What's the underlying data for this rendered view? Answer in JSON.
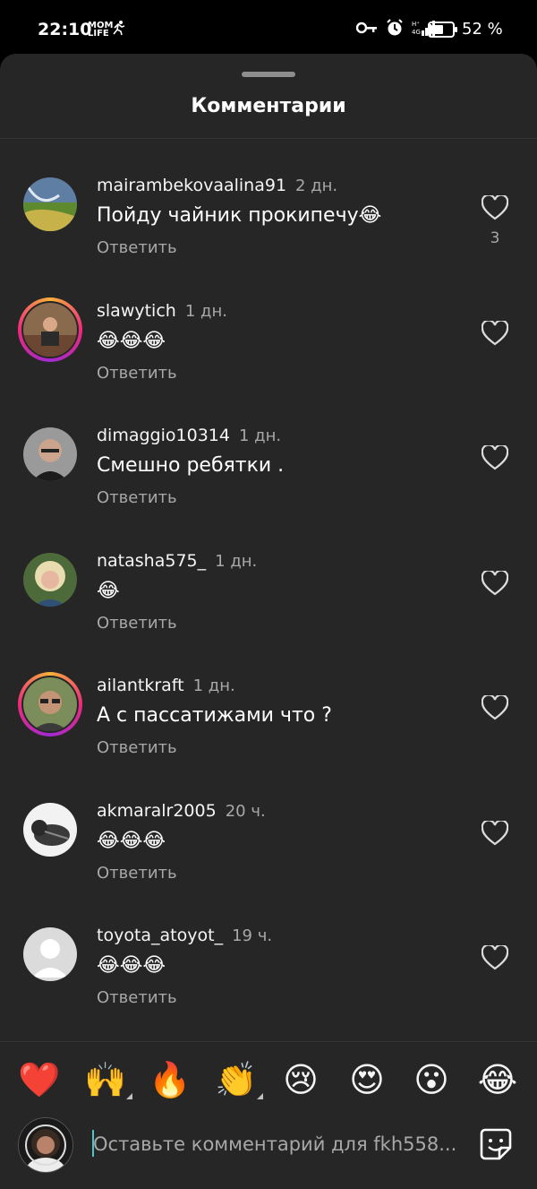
{
  "status_bar": {
    "time": "22:10",
    "notif_text": "MOM LIFE",
    "battery_pct": "52 %",
    "icons": [
      "key-icon",
      "alarm-icon",
      "signal-icon",
      "battery-icon"
    ]
  },
  "sheet": {
    "title": "Комментарии"
  },
  "comments": [
    {
      "username": "mairambekovaalina91",
      "time": "2 дн.",
      "text": "Пойду чайник прокипечу😂",
      "reply": "Ответить",
      "likes": "3",
      "ring": false,
      "avatar": "landscape"
    },
    {
      "username": "slawytich",
      "time": "1 дн.",
      "text": "😂😂😂",
      "reply": "Ответить",
      "likes": "",
      "ring": true,
      "avatar": "person-outdoor"
    },
    {
      "username": "dimaggio10314",
      "time": "1 дн.",
      "text": "Смешно ребятки .",
      "reply": "Ответить",
      "likes": "",
      "ring": false,
      "avatar": "man-dark"
    },
    {
      "username": "natasha575_",
      "time": "1 дн.",
      "text": "😂",
      "reply": "Ответить",
      "likes": "",
      "ring": false,
      "avatar": "woman-blonde"
    },
    {
      "username": "ailantkraft",
      "time": "1 дн.",
      "text": "А с пассатижами что ?",
      "reply": "Ответить",
      "likes": "",
      "ring": true,
      "avatar": "man-glasses"
    },
    {
      "username": "akmaralr2005",
      "time": "20 ч.",
      "text": "😂😂😂",
      "reply": "Ответить",
      "likes": "",
      "ring": false,
      "avatar": "cat-bw"
    },
    {
      "username": "toyota_atoyot_",
      "time": "19 ч.",
      "text": "😂😂😂",
      "reply": "Ответить",
      "likes": "",
      "ring": false,
      "avatar": "default"
    }
  ],
  "reactions": [
    "❤️",
    "🙌",
    "🔥",
    "👏",
    "😢",
    "😍",
    "😮",
    "😂"
  ],
  "input": {
    "placeholder": "Оставьте комментарий для fkh558..."
  },
  "colors": {
    "sheet_bg": "#262626",
    "text_secondary": "#a8a8a8",
    "caret": "#4fc3c7"
  }
}
